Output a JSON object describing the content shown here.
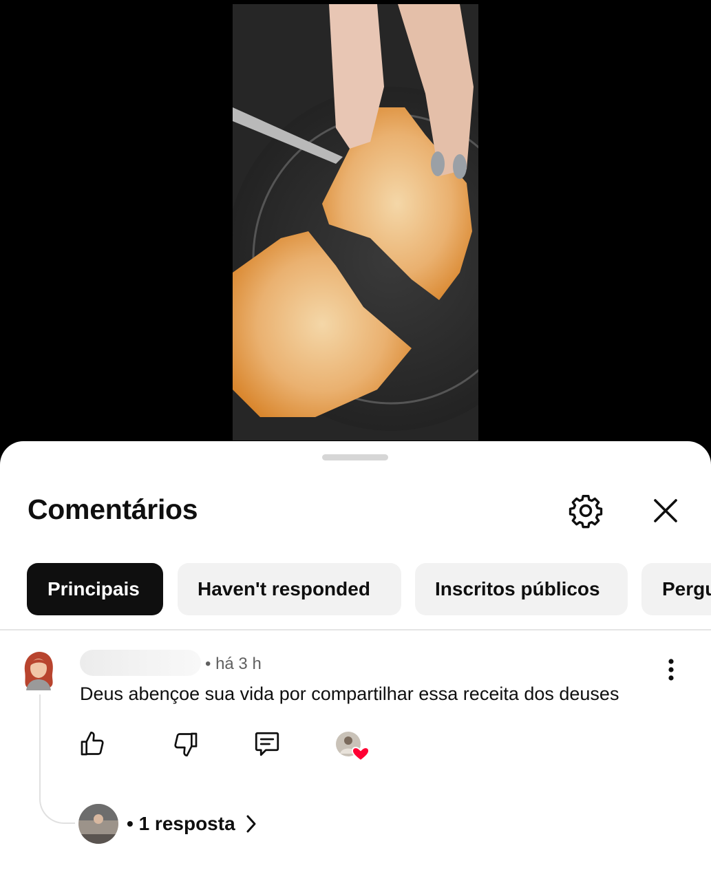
{
  "comments_panel": {
    "title": "Comentários",
    "settings_icon": "gear-icon",
    "close_icon": "close-icon"
  },
  "filters": [
    {
      "label": "Principais",
      "active": true
    },
    {
      "label": "Haven't responded",
      "active": false
    },
    {
      "label": "Inscritos públicos",
      "active": false
    },
    {
      "label": "Pergu",
      "active": false
    }
  ],
  "comment": {
    "timestamp": "• há 3 h",
    "text": "Deus abençoe sua vida por compartilhar essa receita dos deuses",
    "replies_label": "• 1 resposta"
  },
  "colors": {
    "chip_active_bg": "#0f0f0f",
    "chip_bg": "#f2f2f2",
    "heart": "#ff0033",
    "text_primary": "#0f0f0f",
    "text_secondary": "#606060"
  }
}
